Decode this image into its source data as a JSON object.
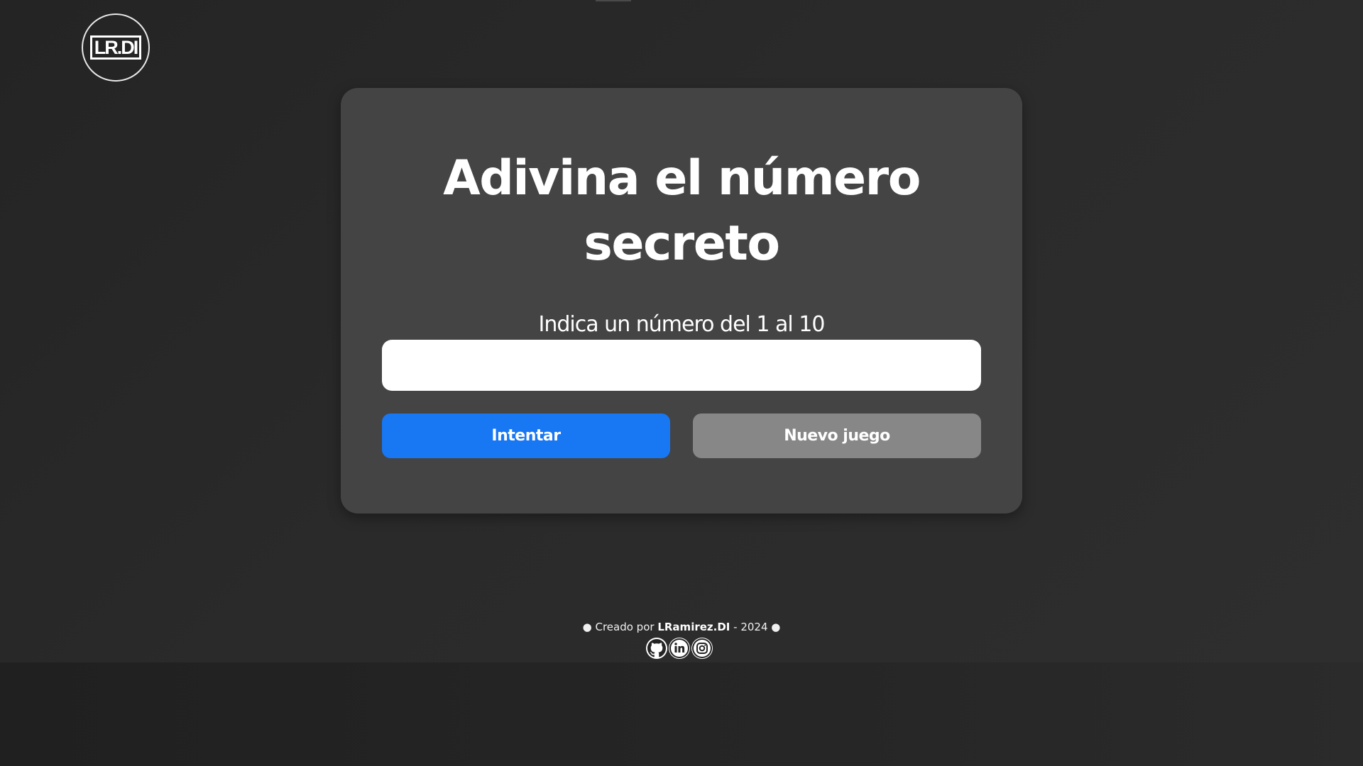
{
  "logo": {
    "text": "LR.DI"
  },
  "game": {
    "title_line1": "Adivina el número",
    "title_line2": "secreto",
    "prompt": "Indica un número del 1 al 10",
    "input_value": "",
    "try_button": "Intentar",
    "new_game_button": "Nuevo juego"
  },
  "footer": {
    "bullet_left": "● Creado por ",
    "author": "LRamirez.DI",
    "year_text": " - 2024 ●",
    "social_icons": [
      "github-icon",
      "linkedin-icon",
      "instagram-icon"
    ]
  },
  "colors": {
    "background": "#242424",
    "card": "#444444",
    "primary_button": "#1877f2",
    "secondary_button": "#878787",
    "text": "#ffffff"
  }
}
